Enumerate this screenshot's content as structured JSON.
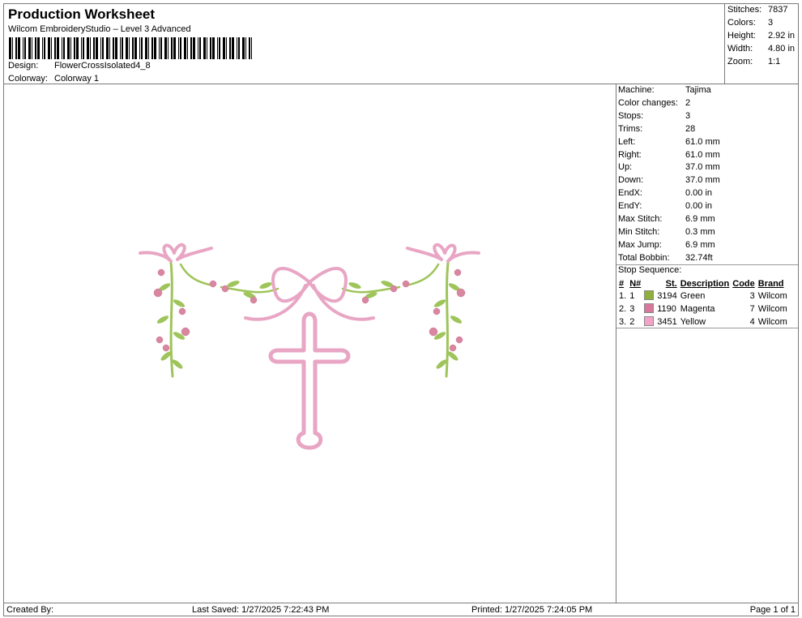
{
  "header": {
    "title": "Production Worksheet",
    "subtitle": "Wilcom EmbroideryStudio – Level 3 Advanced",
    "design_label": "Design:",
    "design_value": "FlowerCrossIsolated4_8",
    "colorway_label": "Colorway:",
    "colorway_value": "Colorway 1"
  },
  "summary": [
    {
      "label": "Stitches:",
      "value": "7837"
    },
    {
      "label": "Colors:",
      "value": "3"
    },
    {
      "label": "Height:",
      "value": "2.92 in"
    },
    {
      "label": "Width:",
      "value": "4.80 in"
    },
    {
      "label": "Zoom:",
      "value": "1:1"
    }
  ],
  "details": [
    {
      "label": "Machine:",
      "value": "Tajima"
    },
    {
      "label": "Color changes:",
      "value": "2"
    },
    {
      "label": "Stops:",
      "value": "3"
    },
    {
      "label": "Trims:",
      "value": "28"
    },
    {
      "label": "Left:",
      "value": "61.0 mm"
    },
    {
      "label": "Right:",
      "value": "61.0 mm"
    },
    {
      "label": "Up:",
      "value": "37.0 mm"
    },
    {
      "label": "Down:",
      "value": "37.0 mm"
    },
    {
      "label": "EndX:",
      "value": "0.00 in"
    },
    {
      "label": "EndY:",
      "value": "0.00 in"
    },
    {
      "label": "Max Stitch:",
      "value": "6.9 mm"
    },
    {
      "label": "Min Stitch:",
      "value": "0.3 mm"
    },
    {
      "label": "Max Jump:",
      "value": "6.9 mm"
    },
    {
      "label": "Total Bobbin:",
      "value": "32.74ft"
    }
  ],
  "stop_sequence": {
    "title": "Stop Sequence:",
    "columns": [
      "#",
      "N#",
      "St.",
      "Description",
      "Code",
      "Brand"
    ],
    "rows": [
      {
        "num": "1.",
        "n": "1",
        "color": "#8fae3a",
        "st": "3194",
        "desc": "Green",
        "code": "3",
        "brand": "Wilcom"
      },
      {
        "num": "2.",
        "n": "3",
        "color": "#d9789c",
        "st": "1190",
        "desc": "Magenta",
        "code": "7",
        "brand": "Wilcom"
      },
      {
        "num": "3.",
        "n": "2",
        "color": "#f4a3c8",
        "st": "3451",
        "desc": "Yellow",
        "code": "4",
        "brand": "Wilcom"
      }
    ]
  },
  "design_colors": {
    "pink": "#e8a6c4",
    "pink_dark": "#c97a9c",
    "green": "#9ec45a",
    "bud": "#d9869f"
  },
  "footer": {
    "created_by": "Created By:",
    "last_saved": "Last Saved: 1/27/2025 7:22:43 PM",
    "printed": "Printed: 1/27/2025 7:24:05 PM",
    "page": "Page 1 of 1"
  }
}
